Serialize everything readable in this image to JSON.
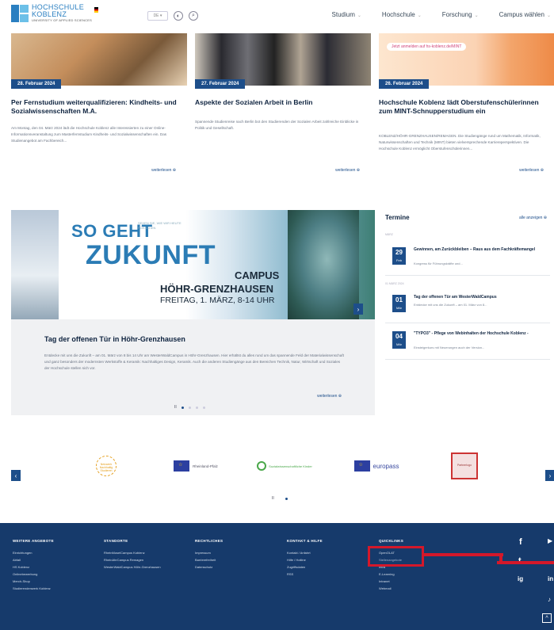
{
  "header": {
    "logo_line1": "HOCHSCHULE",
    "logo_line2": "KOBLENZ",
    "logo_sub": "UNIVERSITY OF APPLIED SCIENCES",
    "lang": "DE ▾",
    "nav": [
      {
        "label": "Studium"
      },
      {
        "label": "Hochschule"
      },
      {
        "label": "Forschung"
      },
      {
        "label": "Campus wählen"
      }
    ]
  },
  "news": [
    {
      "date": "28. Februar 2024",
      "title": "Per Fernstudium weiterqualifizieren: Kindheits- und Sozialwissenschaften M.A.",
      "text": "Am Montag, den 04. März 2024 lädt die Hochschule Koblenz alle Interessierten zu einer Online-Informationsveranstaltung zum Masterfernstudium Kindheits- und Sozialwissenschaften ein. Das Studienangebot am Fachbereich...",
      "more": "weiterlesen"
    },
    {
      "date": "27. Februar 2024",
      "title": "Aspekte der Sozialen Arbeit in Berlin",
      "text": "Spannende Studienreise nach Berlin bot den Studierenden der Sozialen Arbeit zahlreiche Einblicke in Politik und Gesellschaft.",
      "more": "weiterlesen"
    },
    {
      "date": "26. Februar 2024",
      "title": "Hochschule Koblenz lädt Oberstufenschülerinnen zum MINT-Schnupperstudium ein",
      "text": "KOBLENZ/HÖHR-GRENZHAUSEN/REMAGEN. Die Studiengänge rund um Mathematik, Informatik, Naturwissenschaften und Technik (MINT) bieten vielversprechende Karriereperspektiven. Die Hochschule Koblenz ermöglicht Oberstufenschülerinnen...",
      "more": "weiterlesen",
      "banner": "Jetzt anmelden auf hs-koblenz.de/MINT"
    }
  ],
  "slider": {
    "banner_so": "SO GEHT",
    "banner_zukunft": "ZUKUNFT",
    "banner_small": "SEHEN SIE, WIE WIR HEUTE FORSCHEN",
    "banner_campus": "CAMPUS",
    "banner_place": "HÖHR-GRENZHAUSEN",
    "banner_date": "FREITAG, 1. MÄRZ, 8-14 UHR",
    "title": "Tag der offenen Tür in Höhr-Grenzhausen",
    "text": "Entdecke mit uns die Zukunft – am 01. März von 8 bis 14 Uhr am WesterWaldCampus in Höhr-Grenzhausen. Hier erhältst du alles rund um das spannende Feld der Materialwissenschaft und ganz besonders der modernsten Werkstoffe & Keramik: Nachhaltiges Design, Keramik. Auch die anderen Studiengänge aus den Bereichen Technik, Natur, Wirtschaft und Soziales der Hochschule stellen sich vor.",
    "more": "weiterlesen",
    "prev": "‹",
    "next": "›",
    "pause": "II"
  },
  "termine": {
    "heading": "Termine",
    "all": "alle anzeigen",
    "month1": "MÄRZ",
    "month2": "01 MÄRZ 2024",
    "events": [
      {
        "day": "29",
        "wd": "Feb",
        "title": "Gewinnen, am Zurückbleiben – Raus aus dem Fachkräftemangel",
        "desc": "Kongress für Führungskräfte und..."
      },
      {
        "day": "01",
        "wd": "Mär",
        "title": "Tag der offenen Tür am WesterWaldCampus",
        "desc": "Entdecke mit uns die Zukunft – am 01. März von 8..."
      },
      {
        "day": "04",
        "wd": "Mär",
        "title": "\"TYPO3\" - Pflege von Webinhalten der Hochschule Koblenz -",
        "desc": "Einsteigerkurs mit Neuerungen auch der Version..."
      }
    ]
  },
  "partners": [
    {
      "label": "Netzwerk Nachhaltig Studieren"
    },
    {
      "label": "Rheinland-Pfalz"
    },
    {
      "label": "Sozialwissenschaftliche Kinder"
    },
    {
      "label": "europass"
    },
    {
      "label": "Partnerlogo"
    }
  ],
  "footer": {
    "cols": [
      {
        "h": "WEITERE ANGEBOTE",
        "items": [
          "Einrichtungen",
          "Abfall",
          "HS Koblenz",
          "Onlinebewerbung",
          "Merch-Shop",
          "Studierendenwerk Koblenz"
        ]
      },
      {
        "h": "STANDORTE",
        "items": [
          "RheinMoselCampus Koblenz",
          "RheinAhrCampus Remagen",
          "WesterWaldCampus Höhr-Grenzhausen"
        ]
      },
      {
        "h": "RECHTLICHES",
        "items": [
          "Impressum",
          "Barrierefreiheit",
          "Datenschutz"
        ]
      },
      {
        "h": "KONTAKT & HILFE",
        "items": [
          "Kontakt / Anfahrt",
          "Hilfe / Hotline",
          "Zugriffsdaten",
          "RSS"
        ]
      },
      {
        "h": "QUICKLINKS",
        "items": [
          "OpenOLAT",
          "Stellenangebote",
          "Intra",
          "E-Learning",
          "Intranet",
          "Webmail"
        ]
      }
    ],
    "social": [
      "f",
      "t",
      "ig",
      "in",
      "▶",
      "♪"
    ],
    "totop": "^"
  }
}
